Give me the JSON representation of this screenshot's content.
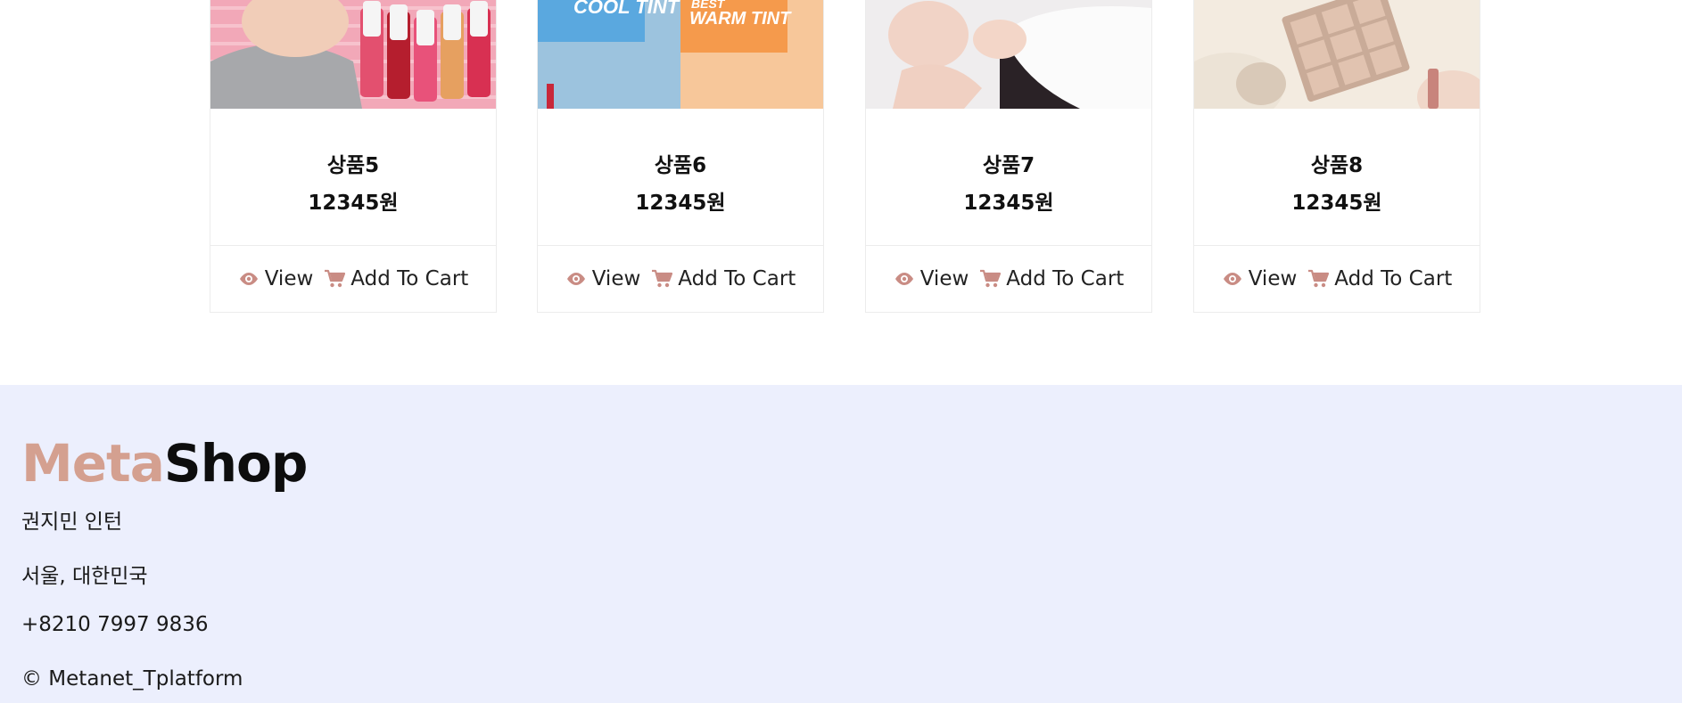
{
  "products": [
    {
      "name": "상품5",
      "price": "12345원",
      "view_label": "View",
      "cart_label": "Add To Cart",
      "image": "lip-tint-bottles"
    },
    {
      "name": "상품6",
      "price": "12345원",
      "view_label": "View",
      "cart_label": "Add To Cart",
      "image": "cool-warm-tint-packages",
      "image_text": [
        "COOL TINT",
        "BEST",
        "WARM TINT"
      ]
    },
    {
      "name": "상품7",
      "price": "12345원",
      "view_label": "View",
      "cart_label": "Add To Cart",
      "image": "model-portrait"
    },
    {
      "name": "상품8",
      "price": "12345원",
      "view_label": "View",
      "cart_label": "Add To Cart",
      "image": "eyeshadow-palette"
    }
  ],
  "icons": {
    "view": "eye-icon",
    "cart": "shopping-cart-icon"
  },
  "colors": {
    "accent": "#d4a090",
    "icon": "#c98c84",
    "footer_bg": "#eceffd"
  },
  "footer": {
    "logo_part1": "Meta",
    "logo_part2": "Shop",
    "name": "권지민 인턴",
    "location": "서울, 대한민국",
    "phone": "+8210 7997 9836",
    "copyright": "©  Metanet_Tplatform"
  }
}
